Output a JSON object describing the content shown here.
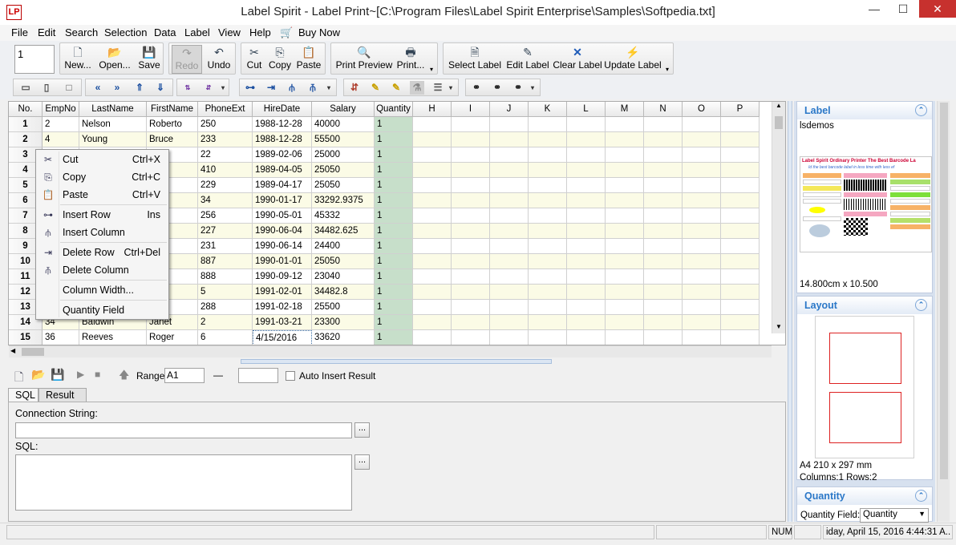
{
  "window": {
    "title": "Label Spirit - Label Print~[C:\\Program Files\\Label Spirit Enterprise\\Samples\\Softpedia.txt]",
    "minimize": "—",
    "maximize": "☐",
    "close": "✕",
    "app_icon": "LP"
  },
  "menu": [
    "File",
    "Edit",
    "Search",
    "Selection",
    "Data",
    "Label",
    "View",
    "Help",
    "Buy Now"
  ],
  "toolbar": {
    "copies_value": "1",
    "new": "New...",
    "open": "Open...",
    "save": "Save",
    "redo": "Redo",
    "undo": "Undo",
    "cut": "Cut",
    "copy": "Copy",
    "paste": "Paste",
    "print_preview": "Print Preview",
    "print": "Print...",
    "select_label": "Select Label",
    "edit_label": "Edit Label",
    "clear_label": "Clear Label",
    "update_label": "Update Label"
  },
  "grid": {
    "columns": [
      "No.",
      "EmpNo",
      "LastName",
      "FirstName",
      "PhoneExt",
      "HireDate",
      "Salary",
      "Quantity",
      "H",
      "I",
      "J",
      "K",
      "L",
      "M",
      "N",
      "O",
      "P"
    ],
    "rows": [
      [
        "1",
        "2",
        "Nelson",
        "Roberto",
        "250",
        "1988-12-28",
        "40000",
        "1"
      ],
      [
        "2",
        "4",
        "Young",
        "Bruce",
        "233",
        "1988-12-28",
        "55500",
        "1"
      ],
      [
        "3",
        "",
        "",
        "",
        "22",
        "1989-02-06",
        "25000",
        "1"
      ],
      [
        "4",
        "",
        "",
        "e",
        "410",
        "1989-04-05",
        "25050",
        "1"
      ],
      [
        "5",
        "",
        "",
        "",
        "229",
        "1989-04-17",
        "25050",
        "1"
      ],
      [
        "6",
        "",
        "",
        "",
        "34",
        "1990-01-17",
        "33292.9375",
        "1"
      ],
      [
        "7",
        "",
        "",
        "",
        "256",
        "1990-05-01",
        "45332",
        "1"
      ],
      [
        "8",
        "",
        "",
        "art",
        "227",
        "1990-06-04",
        "34482.625",
        "1"
      ],
      [
        "9",
        "",
        "",
        "erine",
        "231",
        "1990-06-14",
        "24400",
        "1"
      ],
      [
        "10",
        "",
        "",
        "",
        "887",
        "1990-01-01",
        "25050",
        "1"
      ],
      [
        "11",
        "",
        "",
        "",
        "888",
        "1990-09-12",
        "23040",
        "1"
      ],
      [
        "12",
        "",
        "",
        "",
        "5",
        "1991-02-01",
        "34482.8",
        "1"
      ],
      [
        "13",
        "",
        "",
        "r",
        "288",
        "1991-02-18",
        "25500",
        "1"
      ],
      [
        "14",
        "34",
        "Baldwin",
        "Janet",
        "2",
        "1991-03-21",
        "23300",
        "1"
      ],
      [
        "15",
        "36",
        "Reeves",
        "Roger",
        "6",
        "4/15/2016",
        "33620",
        "1"
      ]
    ]
  },
  "context_menu": [
    {
      "label": "Cut",
      "shortcut": "Ctrl+X"
    },
    {
      "label": "Copy",
      "shortcut": "Ctrl+C"
    },
    {
      "label": "Paste",
      "shortcut": "Ctrl+V"
    },
    {
      "label": "Insert Row",
      "shortcut": "Ins"
    },
    {
      "label": "Insert Column",
      "shortcut": ""
    },
    {
      "label": "Delete Row",
      "shortcut": "Ctrl+Del"
    },
    {
      "label": "Delete Column",
      "shortcut": ""
    },
    {
      "label": "Column Width...",
      "shortcut": ""
    },
    {
      "label": "Quantity Field",
      "shortcut": ""
    }
  ],
  "lower": {
    "range_label": "Range:",
    "range_value": "A1",
    "range_sep": "—",
    "auto_insert": "Auto Insert Result",
    "tab_sql": "SQL",
    "tab_result": "Result",
    "connection_label": "Connection String:",
    "sql_label": "SQL:",
    "browse": "..."
  },
  "right": {
    "label_title": "Label",
    "label_name": "lsdemos",
    "label_size": "14.800cm x 10.500",
    "preview_banner": "Label Spirit Ordinary Printer The Best Barcode La",
    "preview_tagline": "Id the best barcode label in less time with less ef",
    "layout_title": "Layout",
    "layout_paper": "A4 210 x 297 mm",
    "layout_grid": "Columns:1 Rows:2",
    "quantity_title": "Quantity",
    "quantity_field_label": "Quantity Field:",
    "quantity_field_value": "Quantity"
  },
  "status": {
    "num": "NUM",
    "datetime": "iday, April 15, 2016 4:44:31 A.."
  }
}
